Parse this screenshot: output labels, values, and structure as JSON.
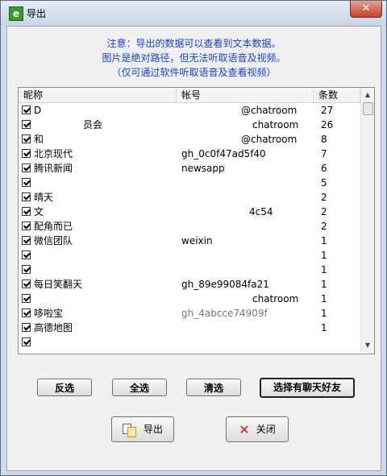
{
  "window": {
    "title": "导出",
    "close_glyph": "✕",
    "app_icon_glyph": "e"
  },
  "notice": {
    "line1": "注意：导出的数据可以查看到文本数据。",
    "line2": "图片是绝对路径，但无法听取语音及视频。",
    "line3": "（仅可通过软件听取语音及查看视频）"
  },
  "table": {
    "columns": {
      "nick": "昵称",
      "account": "帐号",
      "count": "条数"
    },
    "rows": [
      {
        "nick": "D",
        "account": "@chatroom",
        "count": "27"
      },
      {
        "nick": "员会",
        "account": "chatroom",
        "count": "26"
      },
      {
        "nick": "和",
        "account": "@chatroom",
        "count": "8"
      },
      {
        "nick": "北京现代",
        "account": "gh_0c0f47ad5f40",
        "count": "7"
      },
      {
        "nick": "腾讯新闻",
        "account": "newsapp",
        "count": "6"
      },
      {
        "nick": "",
        "account": "",
        "count": "5"
      },
      {
        "nick": "晴天",
        "account": "",
        "count": "2"
      },
      {
        "nick": "文",
        "account": "4c54",
        "count": "2"
      },
      {
        "nick": "配角而已",
        "account": "",
        "count": "2"
      },
      {
        "nick": "微信团队",
        "account": "weixin",
        "count": "1"
      },
      {
        "nick": "",
        "account": "",
        "count": "1"
      },
      {
        "nick": "",
        "account": "",
        "count": "1"
      },
      {
        "nick": "每日笑翻天",
        "account": "gh_89e99084fa21",
        "count": "1"
      },
      {
        "nick": "",
        "account": "chatroom",
        "count": "1"
      },
      {
        "nick": "哆啦宝",
        "account": "gh_4abcce74909f",
        "count": "1"
      },
      {
        "nick": "高德地图",
        "account": "",
        "count": "1"
      },
      {
        "nick": "",
        "account": "",
        "count": ""
      }
    ]
  },
  "scroll": {
    "up": "▲",
    "down": "▼"
  },
  "buttons": {
    "invert": "反选",
    "select_all": "全选",
    "clear": "清选",
    "select_chat_friends": "选择有聊天好友",
    "export": "导出",
    "close": "关闭"
  },
  "icons": {
    "close_x": "✕"
  }
}
